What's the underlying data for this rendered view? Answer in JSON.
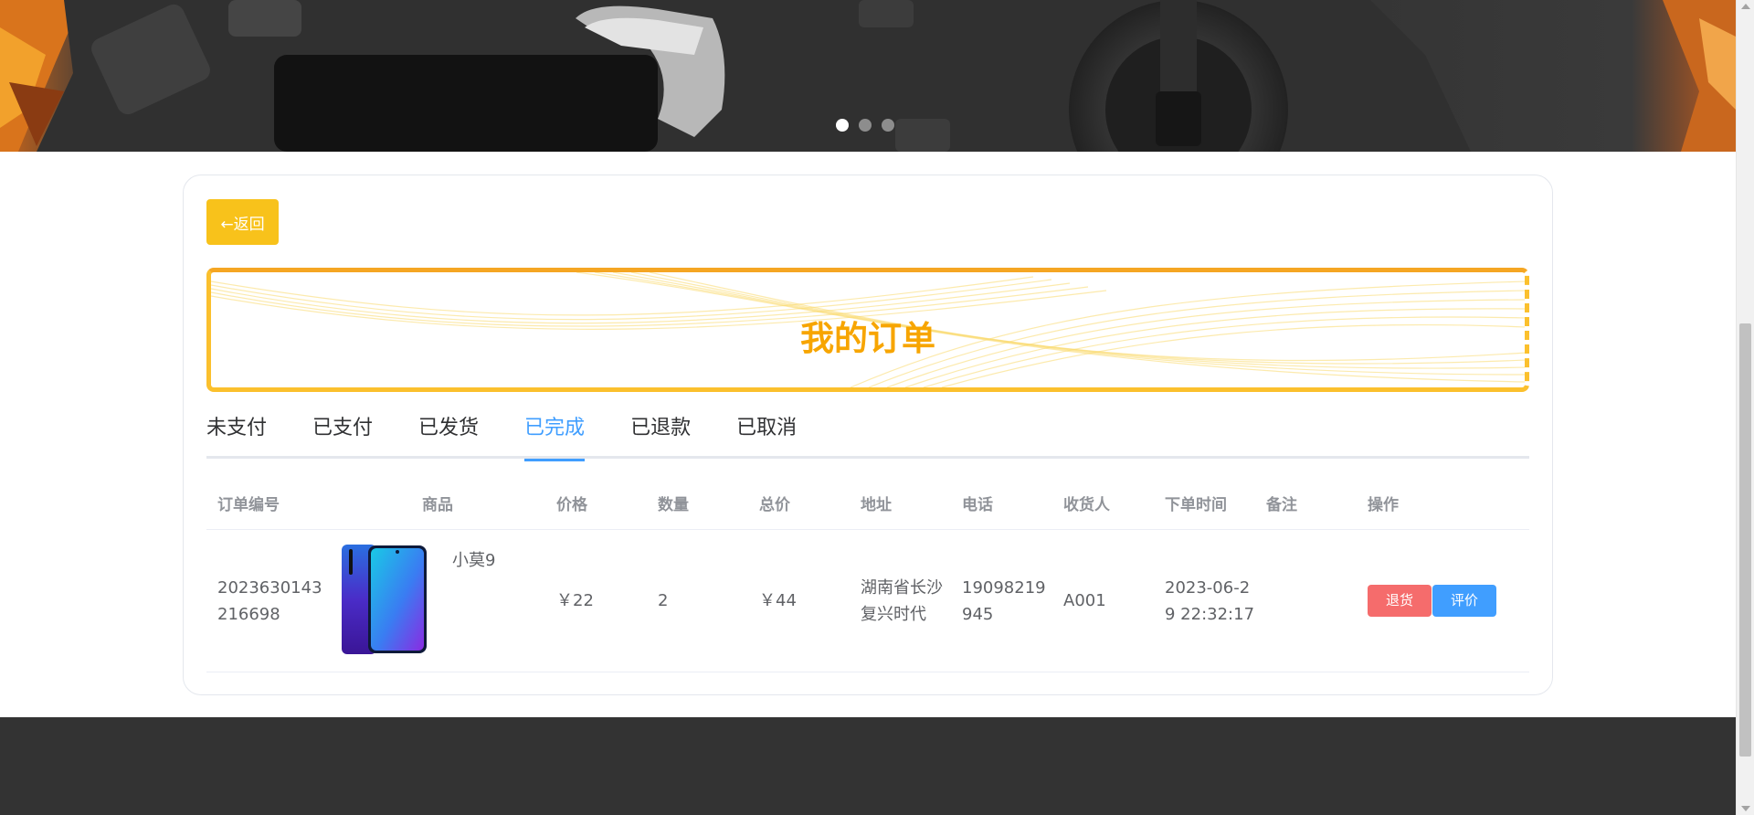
{
  "banner": {
    "slides": 3,
    "active_slide": 1
  },
  "toolbar": {
    "back_label": "←返回"
  },
  "page": {
    "title": "我的订单"
  },
  "tabs": [
    {
      "label": "未支付",
      "active": false
    },
    {
      "label": "已支付",
      "active": false
    },
    {
      "label": "已发货",
      "active": false
    },
    {
      "label": "已完成",
      "active": true
    },
    {
      "label": "已退款",
      "active": false
    },
    {
      "label": "已取消",
      "active": false
    }
  ],
  "table": {
    "headers": [
      "订单编号",
      "商品",
      "价格",
      "数量",
      "总价",
      "地址",
      "电话",
      "收货人",
      "下单时间",
      "备注",
      "操作"
    ],
    "rows": [
      {
        "order_id": "2023630143216698",
        "product_name": "小莫9",
        "price": "￥22",
        "quantity": "2",
        "total": "￥44",
        "address": "湖南省长沙复兴时代",
        "phone": "19098219945",
        "receiver": "A001",
        "order_time": "2023-06-29 22:32:17",
        "note": "",
        "actions": {
          "refund": "退货",
          "review": "评价"
        }
      }
    ]
  },
  "colors": {
    "accent": "#409eff",
    "back_button": "#f8c21b",
    "title": "#f7a500",
    "danger": "#f56c6c",
    "footer": "#333333"
  }
}
